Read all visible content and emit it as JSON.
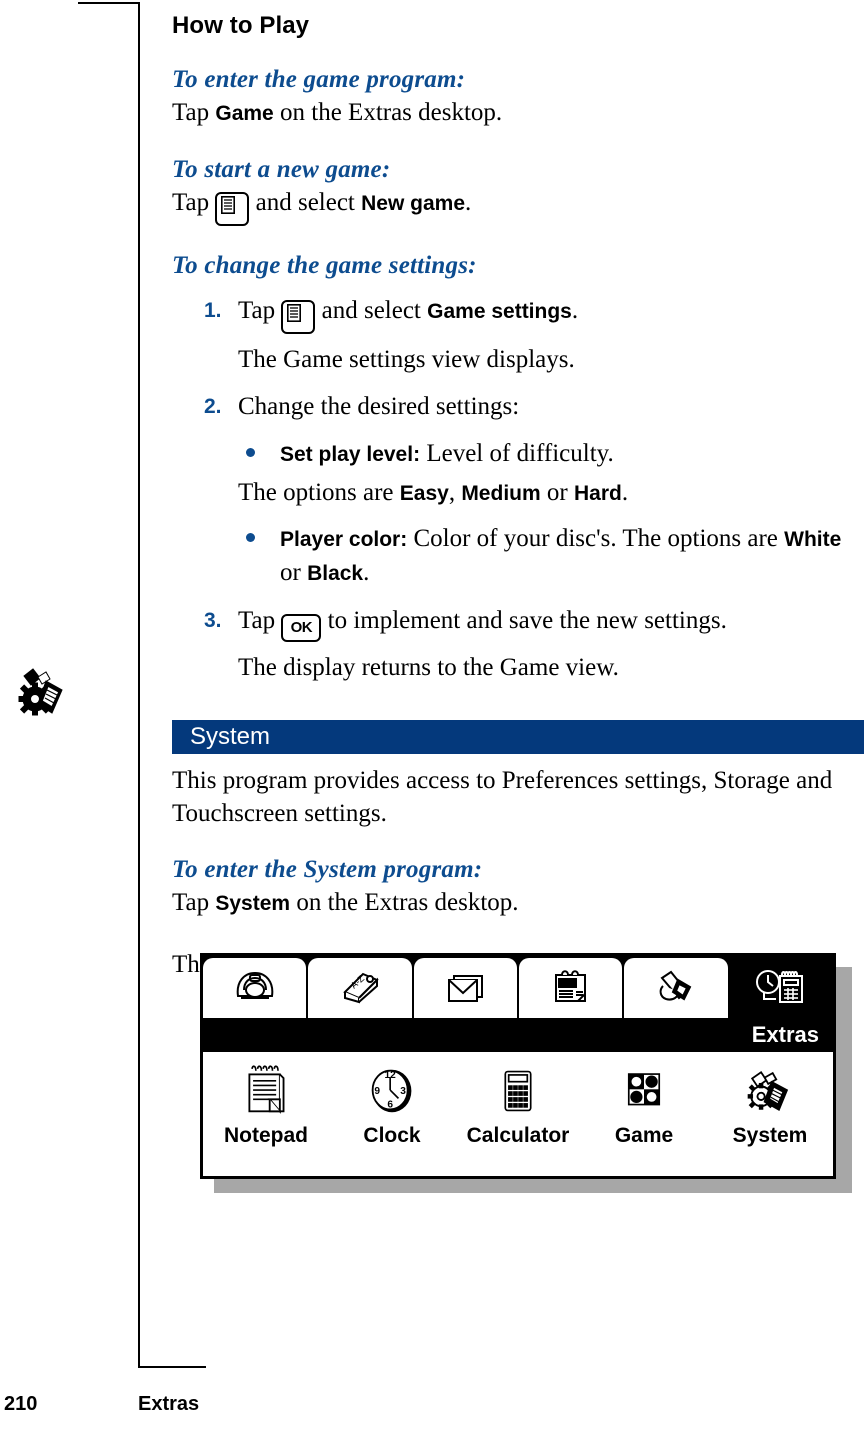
{
  "page": {
    "number": "210",
    "section": "Extras"
  },
  "margin_icon": "system-gear-stylus-icon",
  "how_to_play": {
    "heading": "How to Play",
    "enter_game": {
      "heading": "To enter the game program:",
      "text_before": "Tap ",
      "bold": "Game",
      "text_after": " on the Extras desktop."
    },
    "start_new_game": {
      "heading": "To start a new game:",
      "text_before": "Tap ",
      "icon": "menu-key-icon",
      "text_mid": " and select ",
      "bold": "New game",
      "text_after": "."
    },
    "change_settings": {
      "heading": "To change the game settings:",
      "steps": [
        {
          "num": "1.",
          "text_before": "Tap ",
          "icon": "menu-key-icon",
          "text_mid": " and select ",
          "bold": "Game settings",
          "text_after": ".",
          "sub": "The Game settings view displays."
        },
        {
          "num": "2.",
          "text": "Change the desired settings:"
        },
        {
          "num": "3.",
          "text_before": "Tap ",
          "icon": "ok-key-icon",
          "icon_label": "OK",
          "text_after": " to implement and save the new settings.",
          "sub": "The display returns to the Game view."
        }
      ],
      "bullets": [
        {
          "label": "Set play level:",
          "text": " Level of difficulty.",
          "follow_before": "The options are ",
          "follow_opt1": "Easy",
          "follow_sep1": ", ",
          "follow_opt2": "Medium",
          "follow_sep2": " or ",
          "follow_opt3": "Hard",
          "follow_end": "."
        },
        {
          "label": "Player color:",
          "text": " Color of your disc's. The options are ",
          "opt1": "White",
          "sep1": " or ",
          "opt2": "Black",
          "end": "."
        }
      ]
    }
  },
  "system_section": {
    "banner": "System",
    "intro": "This program provides  access to Preferences settings, Storage and Touchscreen settings.",
    "enter_system": {
      "heading": "To enter the System program:",
      "text_before": "Tap ",
      "bold": "System",
      "text_after": " on the Extras desktop."
    },
    "view_note": "The System view displays."
  },
  "device_screenshot": {
    "tabs": [
      {
        "name": "telephone-tab",
        "icon": "telephone-icon",
        "selected": false
      },
      {
        "name": "contacts-tab",
        "icon": "address-book-az-icon",
        "selected": false
      },
      {
        "name": "messaging-tab",
        "icon": "envelope-icon",
        "selected": false
      },
      {
        "name": "calendar-tab",
        "icon": "calendar-icon",
        "selected": false
      },
      {
        "name": "office-tab",
        "icon": "pen-tools-icon",
        "selected": false
      },
      {
        "name": "extras-tab",
        "icon": "clock-calculator-icon",
        "selected": true
      }
    ],
    "active_tab_label": "Extras",
    "apps": [
      {
        "label": "Notepad",
        "icon": "notepad-icon"
      },
      {
        "label": "Clock",
        "icon": "clock-icon"
      },
      {
        "label": "Calculator",
        "icon": "calculator-icon"
      },
      {
        "label": "Game",
        "icon": "othello-game-icon"
      },
      {
        "label": "System",
        "icon": "system-gear-icon"
      }
    ],
    "clock_numerals": [
      "12",
      "3",
      "6",
      "9"
    ]
  },
  "colors": {
    "banner_blue": "#04397c",
    "heading_blue": "#0d4c8f",
    "shadow_gray": "#a7a7a7"
  }
}
